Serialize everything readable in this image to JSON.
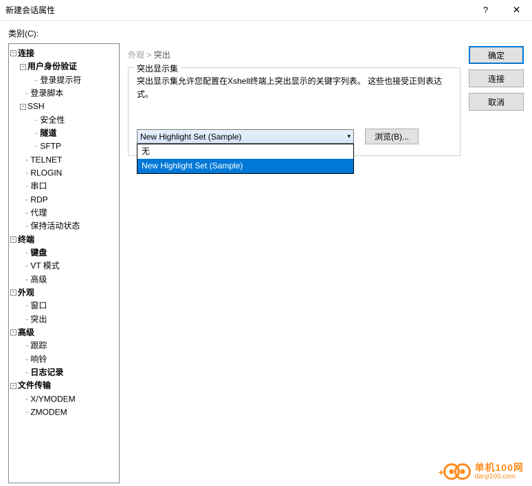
{
  "window": {
    "title": "新建会话属性",
    "help": "?",
    "close": "✕"
  },
  "category_label": "类别(C):",
  "tree": {
    "connection": "连接",
    "user_auth": "用户身份验证",
    "login_prompt": "登录提示符",
    "login_script": "登录脚本",
    "ssh": "SSH",
    "security": "安全性",
    "tunnel": "隧道",
    "sftp": "SFTP",
    "telnet": "TELNET",
    "rlogin": "RLOGIN",
    "serial": "串口",
    "rdp": "RDP",
    "proxy": "代理",
    "keepalive": "保持活动状态",
    "terminal": "终端",
    "keyboard": "键盘",
    "vtmode": "VT 模式",
    "advanced_term": "高级",
    "appearance": "外观",
    "window": "窗口",
    "highlight": "突出",
    "advanced": "高级",
    "trace": "跟踪",
    "bell": "响铃",
    "logging": "日志记录",
    "filetransfer": "文件传输",
    "xymodem": "X/YMODEM",
    "zmodem": "ZMODEM"
  },
  "breadcrumb": {
    "parent": "外观",
    "sep": ">",
    "current": "突出"
  },
  "fieldset_title": "突出显示集",
  "description": "突出显示集允许您配置在Xshell终端上突出显示的关键字列表。 这些也接受正则表达式。",
  "combo": {
    "selected": "New Highlight Set (Sample)",
    "options": [
      "无",
      "New Highlight Set (Sample)"
    ]
  },
  "browse_btn": "浏览(B)...",
  "buttons": {
    "ok": "确定",
    "connect": "连接",
    "cancel": "取消"
  },
  "watermark": {
    "title": "单机100网",
    "subtitle": "danji100.com"
  }
}
